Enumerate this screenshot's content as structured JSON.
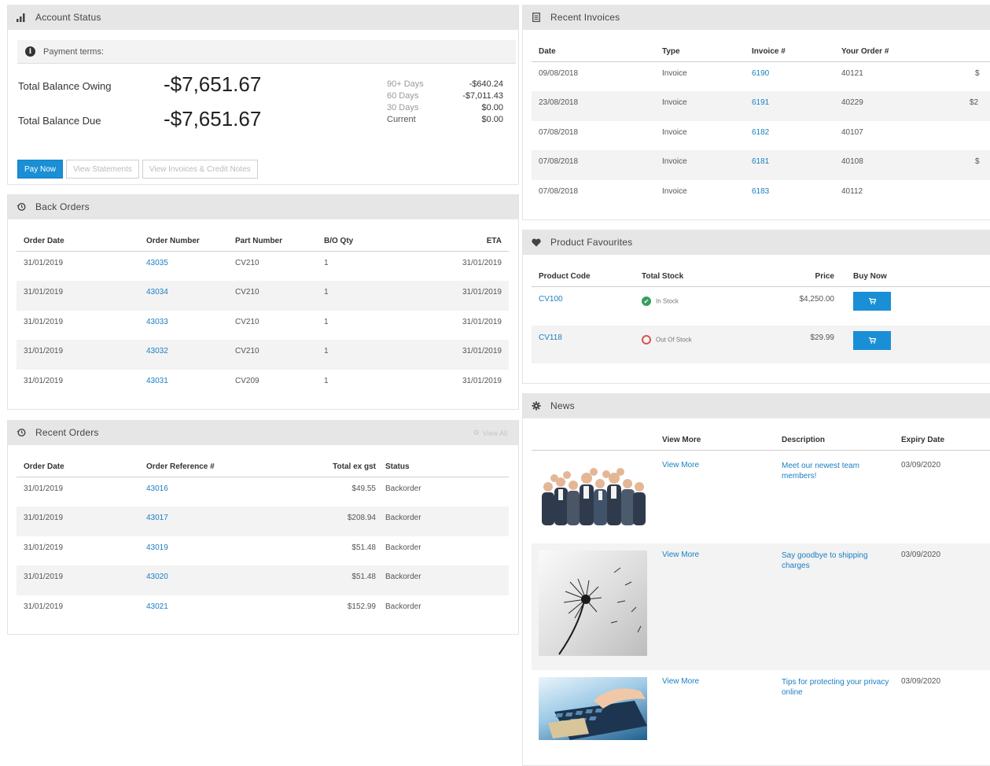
{
  "account_status": {
    "title": "Account Status",
    "payment_terms_label": "Payment terms:",
    "total_balance_owing_label": "Total Balance Owing",
    "total_balance_owing_value": "-$7,651.67",
    "total_balance_due_label": "Total Balance Due",
    "total_balance_due_value": "-$7,651.67",
    "aging": [
      {
        "label": "90+ Days",
        "value": "-$640.24"
      },
      {
        "label": "60 Days",
        "value": "-$7,011.43"
      },
      {
        "label": "30 Days",
        "value": "$0.00"
      },
      {
        "label": "Current",
        "value": "$0.00"
      }
    ],
    "pay_now": "Pay Now",
    "view_statements": "View Statements",
    "view_invoices": "View Invoices & Credit Notes"
  },
  "back_orders": {
    "title": "Back Orders",
    "columns": [
      "Order Date",
      "Order Number",
      "Part Number",
      "B/O Qty",
      "ETA"
    ],
    "rows": [
      {
        "date": "31/01/2019",
        "order": "43035",
        "part": "CV210",
        "qty": "1",
        "eta": "31/01/2019"
      },
      {
        "date": "31/01/2019",
        "order": "43034",
        "part": "CV210",
        "qty": "1",
        "eta": "31/01/2019"
      },
      {
        "date": "31/01/2019",
        "order": "43033",
        "part": "CV210",
        "qty": "1",
        "eta": "31/01/2019"
      },
      {
        "date": "31/01/2019",
        "order": "43032",
        "part": "CV210",
        "qty": "1",
        "eta": "31/01/2019"
      },
      {
        "date": "31/01/2019",
        "order": "43031",
        "part": "CV209",
        "qty": "1",
        "eta": "31/01/2019"
      }
    ]
  },
  "recent_orders": {
    "title": "Recent Orders",
    "view_all": "View All",
    "columns": [
      "Order Date",
      "Order Reference #",
      "Total ex gst",
      "Status"
    ],
    "rows": [
      {
        "date": "31/01/2019",
        "ref": "43016",
        "total": "$49.55",
        "status": "Backorder"
      },
      {
        "date": "31/01/2019",
        "ref": "43017",
        "total": "$208.94",
        "status": "Backorder"
      },
      {
        "date": "31/01/2019",
        "ref": "43019",
        "total": "$51.48",
        "status": "Backorder"
      },
      {
        "date": "31/01/2019",
        "ref": "43020",
        "total": "$51.48",
        "status": "Backorder"
      },
      {
        "date": "31/01/2019",
        "ref": "43021",
        "total": "$152.99",
        "status": "Backorder"
      }
    ]
  },
  "recent_invoices": {
    "title": "Recent Invoices",
    "columns": [
      "Date",
      "Type",
      "Invoice #",
      "Your Order #"
    ],
    "rows": [
      {
        "date": "09/08/2018",
        "type": "Invoice",
        "invoice": "6190",
        "order": "40121",
        "amount": "$"
      },
      {
        "date": "23/08/2018",
        "type": "Invoice",
        "invoice": "6191",
        "order": "40229",
        "amount": "$2"
      },
      {
        "date": "07/08/2018",
        "type": "Invoice",
        "invoice": "6182",
        "order": "40107",
        "amount": ""
      },
      {
        "date": "07/08/2018",
        "type": "Invoice",
        "invoice": "6181",
        "order": "40108",
        "amount": "$"
      },
      {
        "date": "07/08/2018",
        "type": "Invoice",
        "invoice": "6183",
        "order": "40112",
        "amount": ""
      }
    ]
  },
  "product_favourites": {
    "title": "Product Favourites",
    "columns": [
      "Product Code",
      "Total Stock",
      "Price",
      "Buy Now"
    ],
    "rows": [
      {
        "code": "CV100",
        "stock": "In Stock",
        "in_stock": true,
        "price": "$4,250.00"
      },
      {
        "code": "CV118",
        "stock": "Out Of Stock",
        "in_stock": false,
        "price": "$29.99"
      }
    ]
  },
  "news": {
    "title": "News",
    "columns": [
      "View More",
      "Description",
      "Expiry Date"
    ],
    "rows": [
      {
        "image": "team-photo",
        "view_more": "View More",
        "description": "Meet our newest team members!",
        "expiry": "03/09/2020"
      },
      {
        "image": "dandelion-photo",
        "view_more": "View More",
        "description": "Say goodbye to shipping charges",
        "expiry": "03/09/2020"
      },
      {
        "image": "keyboard-card-photo",
        "view_more": "View More",
        "description": "Tips for protecting your privacy online",
        "expiry": "03/09/2020"
      }
    ]
  },
  "colors": {
    "accent": "#1a8fd6",
    "link": "#1a7fc1",
    "header_bg": "#e6e6e6",
    "in_stock": "#3a9d5d",
    "out_of_stock": "#d9534f"
  }
}
